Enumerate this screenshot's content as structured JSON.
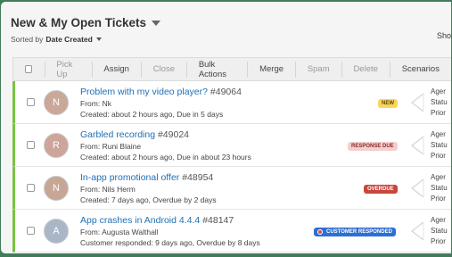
{
  "header": {
    "title": "New & My Open Tickets",
    "sorted_by_label": "Sorted by",
    "sorted_by_value": "Date Created",
    "right_text": "Sho"
  },
  "toolbar": {
    "buttons": [
      {
        "label": "Pick Up",
        "enabled": false
      },
      {
        "label": "Assign",
        "enabled": true
      },
      {
        "label": "Close",
        "enabled": false
      },
      {
        "label": "Bulk Actions",
        "enabled": true
      },
      {
        "label": "Merge",
        "enabled": true
      },
      {
        "label": "Spam",
        "enabled": false
      },
      {
        "label": "Delete",
        "enabled": false
      },
      {
        "label": "Scenarios",
        "enabled": true
      }
    ]
  },
  "colors": {
    "status_bar": "#7ac143",
    "link": "#1f6fb5",
    "background": "#3f7d5a"
  },
  "side_labels": [
    "Ager",
    "Statu",
    "Prior"
  ],
  "tickets": [
    {
      "avatar_letter": "N",
      "avatar_color": "#c9a898",
      "subject": "Problem with my video player?",
      "number": "#49064",
      "from_label": "From:",
      "from": "Nk",
      "meta": "Created: about 2 hours ago, Due in 5 days",
      "badge": "NEW",
      "badge_type": "new"
    },
    {
      "avatar_letter": "R",
      "avatar_color": "#cda59a",
      "subject": "Garbled recording",
      "number": "#49024",
      "from_label": "From:",
      "from": "Runi Blaine",
      "meta": "Created: about 2 hours ago, Due in about 23 hours",
      "badge": "RESPONSE DUE",
      "badge_type": "response"
    },
    {
      "avatar_letter": "N",
      "avatar_color": "#c8a696",
      "subject": "In-app promotional offer",
      "number": "#48954",
      "from_label": "From:",
      "from": "Nils Herm",
      "meta": "Created: 7 days ago, Overdue by 2 days",
      "badge": "OVERDUE",
      "badge_type": "overdue"
    },
    {
      "avatar_letter": "A",
      "avatar_color": "#aab6c8",
      "subject": "App crashes in Android 4.4.4",
      "number": "#48147",
      "from_label": "From:",
      "from": "Augusta Walthall",
      "meta": "Customer responded: 9 days ago, Overdue by 8 days",
      "badge": "CUSTOMER RESPONDED",
      "badge_type": "customer"
    }
  ]
}
